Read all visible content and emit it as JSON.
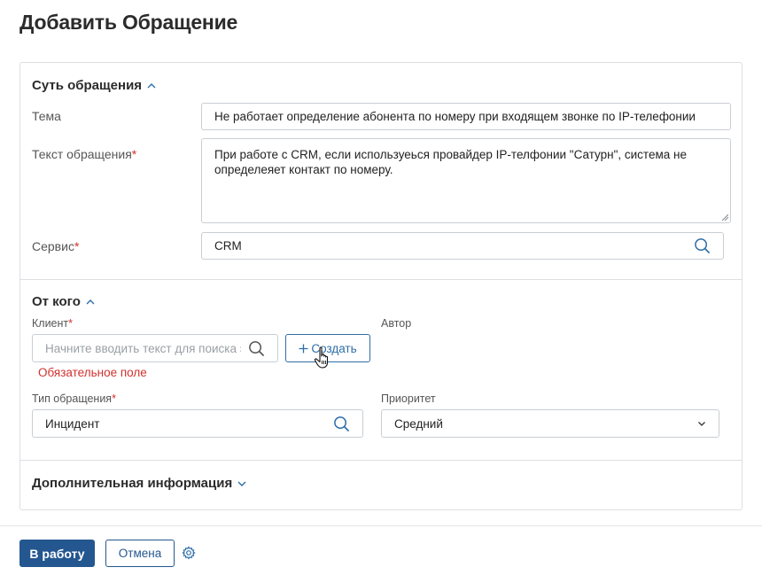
{
  "page": {
    "title": "Добавить Обращение"
  },
  "section_essence": {
    "title": "Суть обращения",
    "topic": {
      "label": "Тема",
      "value": "Не работает определение абонента по номеру при входящем звонке по IP-телефонии"
    },
    "text": {
      "label": "Текст обращения",
      "required_mark": "*",
      "value": "При работе с CRM, если используеься провайдер IP-телфонии \"Сатурн\", система не определеяет контакт по номеру."
    },
    "service": {
      "label": "Сервис",
      "required_mark": "*",
      "value": "CRM"
    }
  },
  "section_from": {
    "title": "От кого",
    "client": {
      "label": "Клиент",
      "required_mark": "*",
      "placeholder": "Начните вводить текст для поиска эл",
      "error": "Обязательное поле"
    },
    "create_button": {
      "icon": "plus-icon",
      "label": "Создать"
    },
    "author": {
      "label": "Автор"
    },
    "request_type": {
      "label": "Тип обращения",
      "required_mark": "*",
      "value": "Инцидент"
    },
    "priority": {
      "label": "Приоритет",
      "value": "Средний"
    }
  },
  "section_extra": {
    "title": "Дополнительная информация"
  },
  "footer": {
    "submit_label": "В работу",
    "cancel_label": "Отмена",
    "settings_icon": "gear-icon"
  },
  "colors": {
    "primary": "#24578f",
    "link": "#2e6ea6",
    "error": "#d0312d",
    "border": "#c9ced4"
  }
}
